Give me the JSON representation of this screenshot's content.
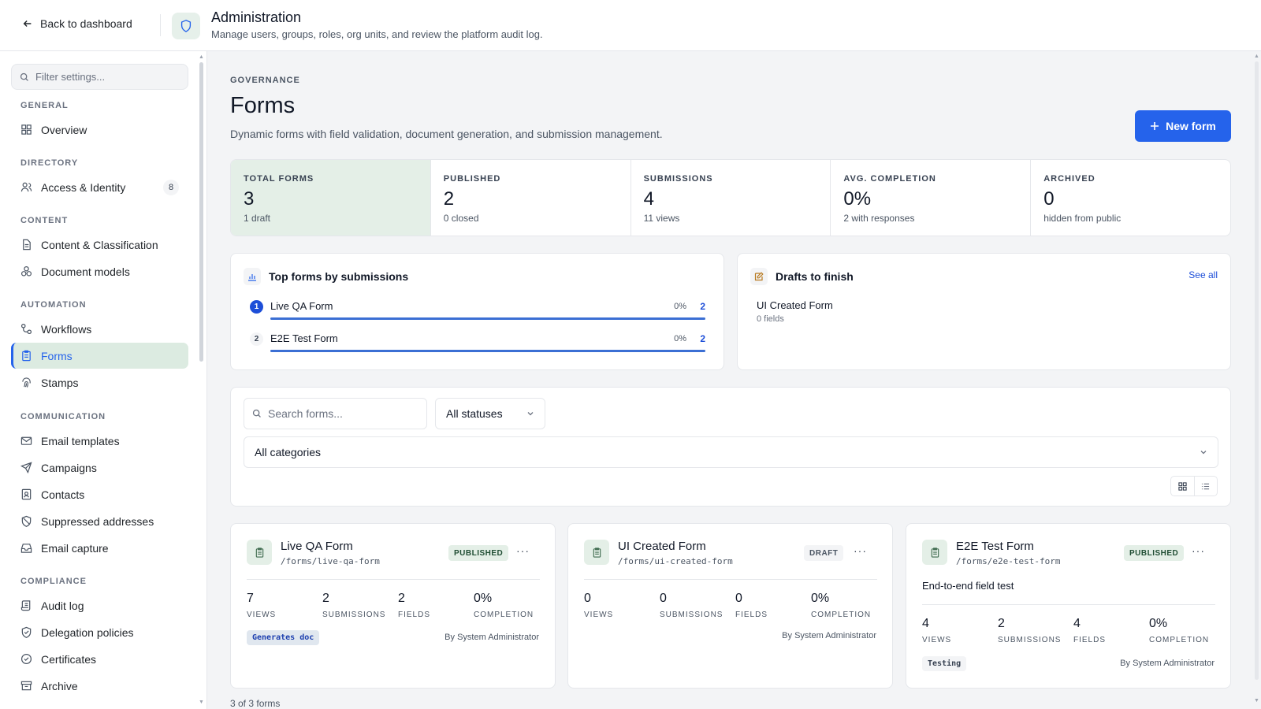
{
  "header": {
    "back_label": "Back to dashboard",
    "title": "Administration",
    "subtitle": "Manage users, groups, roles, org units, and review the platform audit log."
  },
  "sidebar": {
    "filter_placeholder": "Filter settings...",
    "sections": {
      "general": "GENERAL",
      "directory": "DIRECTORY",
      "content": "CONTENT",
      "automation": "AUTOMATION",
      "communication": "COMMUNICATION",
      "compliance": "COMPLIANCE"
    },
    "items": {
      "overview": "Overview",
      "access": "Access & Identity",
      "access_badge": "8",
      "content_class": "Content & Classification",
      "doc_models": "Document models",
      "workflows": "Workflows",
      "forms": "Forms",
      "stamps": "Stamps",
      "email_templates": "Email templates",
      "campaigns": "Campaigns",
      "contacts": "Contacts",
      "suppressed": "Suppressed addresses",
      "email_capture": "Email capture",
      "audit_log": "Audit log",
      "delegation": "Delegation policies",
      "certificates": "Certificates",
      "archive": "Archive"
    }
  },
  "page": {
    "eyebrow": "GOVERNANCE",
    "title": "Forms",
    "description": "Dynamic forms with field validation, document generation, and submission management.",
    "new_button": "New form"
  },
  "stats": [
    {
      "label": "TOTAL FORMS",
      "value": "3",
      "sub": "1 draft"
    },
    {
      "label": "PUBLISHED",
      "value": "2",
      "sub": "0 closed"
    },
    {
      "label": "SUBMISSIONS",
      "value": "4",
      "sub": "11 views"
    },
    {
      "label": "AVG. COMPLETION",
      "value": "0%",
      "sub": "2 with responses"
    },
    {
      "label": "ARCHIVED",
      "value": "0",
      "sub": "hidden from public"
    }
  ],
  "top_forms": {
    "title": "Top forms by submissions",
    "rows": [
      {
        "rank": "1",
        "name": "Live QA Form",
        "pct": "0%",
        "count": "2",
        "share": 1.0
      },
      {
        "rank": "2",
        "name": "E2E Test Form",
        "pct": "0%",
        "count": "2",
        "share": 1.0
      }
    ]
  },
  "drafts": {
    "title": "Drafts to finish",
    "see_all": "See all",
    "items": [
      {
        "name": "UI Created Form",
        "sub": "0 fields"
      }
    ]
  },
  "filters": {
    "search_placeholder": "Search forms...",
    "status": "All statuses",
    "category": "All categories"
  },
  "cards": [
    {
      "title": "Live QA Form",
      "path": "/forms/live-qa-form",
      "status": "PUBLISHED",
      "description": "",
      "metrics": [
        {
          "value": "7",
          "label": "VIEWS"
        },
        {
          "value": "2",
          "label": "SUBMISSIONS"
        },
        {
          "value": "2",
          "label": "FIELDS"
        },
        {
          "value": "0%",
          "label": "COMPLETION"
        }
      ],
      "tag": "Generates doc",
      "author": "By System Administrator"
    },
    {
      "title": "UI Created Form",
      "path": "/forms/ui-created-form",
      "status": "DRAFT",
      "description": "",
      "metrics": [
        {
          "value": "0",
          "label": "VIEWS"
        },
        {
          "value": "0",
          "label": "SUBMISSIONS"
        },
        {
          "value": "0",
          "label": "FIELDS"
        },
        {
          "value": "0%",
          "label": "COMPLETION"
        }
      ],
      "tag": "",
      "author": "By System Administrator"
    },
    {
      "title": "E2E Test Form",
      "path": "/forms/e2e-test-form",
      "status": "PUBLISHED",
      "description": "End-to-end field test",
      "metrics": [
        {
          "value": "4",
          "label": "VIEWS"
        },
        {
          "value": "2",
          "label": "SUBMISSIONS"
        },
        {
          "value": "4",
          "label": "FIELDS"
        },
        {
          "value": "0%",
          "label": "COMPLETION"
        }
      ],
      "tag": "Testing",
      "author": "By System Administrator"
    }
  ],
  "footer": {
    "count": "3 of 3 forms"
  },
  "colors": {
    "accent": "#2563eb",
    "highlight": "#e4efe7",
    "active_nav": "#dcebe1"
  }
}
